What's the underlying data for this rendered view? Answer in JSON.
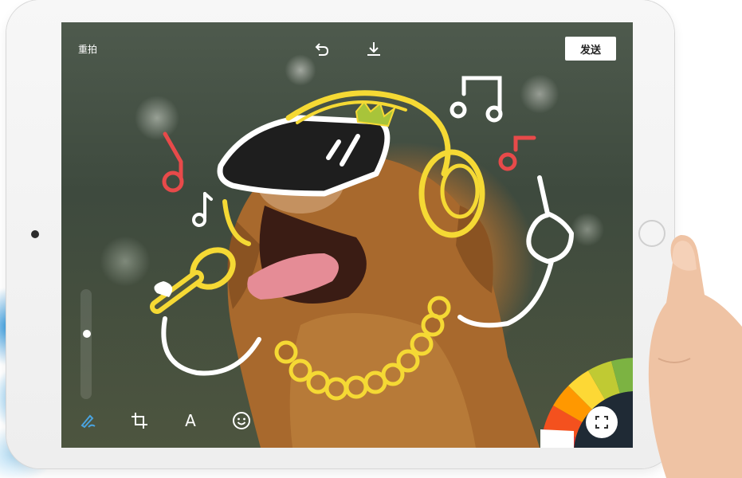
{
  "toolbar": {
    "retake_label": "重拍",
    "send_label": "发送"
  },
  "icons": {
    "undo": "undo-icon",
    "download": "download-icon",
    "pen": "pen-icon",
    "crop": "crop-icon",
    "text": "text-icon",
    "emoji": "emoji-icon",
    "expand": "expand-icon"
  },
  "tools": {
    "text_label": "A"
  },
  "brush_size": 0.6,
  "palette": [
    "#e53935",
    "#f4511e",
    "#ff9800",
    "#fdd835",
    "#c0ca33",
    "#7cb342"
  ],
  "colors": {
    "doodle_yellow": "#f5d934",
    "doodle_white": "#ffffff",
    "doodle_red": "#e84a4a",
    "accent_blue": "#4aa3df"
  }
}
